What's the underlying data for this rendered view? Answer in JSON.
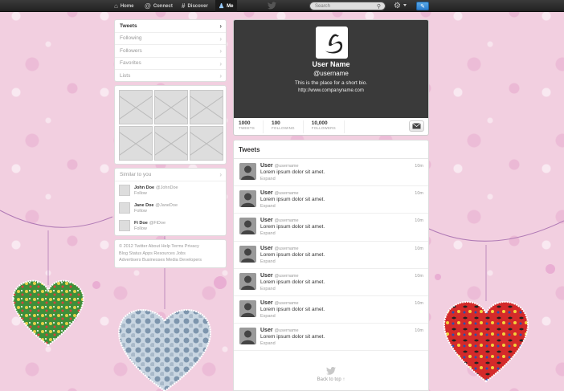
{
  "topbar": {
    "nav": [
      {
        "label": "Home",
        "icon": "home-icon"
      },
      {
        "label": "Connect",
        "icon": "at-icon"
      },
      {
        "label": "Discover",
        "icon": "hash-icon"
      },
      {
        "label": "Me",
        "icon": "person-icon"
      }
    ],
    "search_placeholder": "Search"
  },
  "sidebar": {
    "items": [
      {
        "label": "Tweets"
      },
      {
        "label": "Following"
      },
      {
        "label": "Followers"
      },
      {
        "label": "Favorites"
      },
      {
        "label": "Lists"
      }
    ]
  },
  "similar": {
    "header": "Similar to you",
    "users": [
      {
        "name": "John Doe",
        "handle": "@JohnDoe",
        "follow": "Follow"
      },
      {
        "name": "Jane Doe",
        "handle": "@JaneDoe",
        "follow": "Follow"
      },
      {
        "name": "Fi Doe",
        "handle": "@FiDoe",
        "follow": "Follow"
      }
    ]
  },
  "footer": {
    "line1": "© 2012 Twitter  About  Help  Terms  Privacy",
    "line2": "Blog  Status  Apps  Resources  Jobs",
    "line3": "Advertisers  Businesses  Media  Developers"
  },
  "profile": {
    "name": "User Name",
    "username": "@username",
    "bio": "This is the place for a short bio.",
    "url": "http://www.companyname.com",
    "stats": [
      {
        "value": "1000",
        "label": "TWEETS"
      },
      {
        "value": "100",
        "label": "FOLLOWING"
      },
      {
        "value": "10,000",
        "label": "FOLLOWERS"
      }
    ]
  },
  "tweets": {
    "header": "Tweets",
    "items": [
      {
        "name": "User",
        "handle": "@username",
        "text": "Lorem ipsum dolor sit amet.",
        "expand": "Expand",
        "time": "10m"
      },
      {
        "name": "User",
        "handle": "@username",
        "text": "Lorem ipsum dolor sit amet.",
        "expand": "Expand",
        "time": "10m"
      },
      {
        "name": "User",
        "handle": "@username",
        "text": "Lorem ipsum dolor sit amet.",
        "expand": "Expand",
        "time": "10m"
      },
      {
        "name": "User",
        "handle": "@username",
        "text": "Lorem ipsum dolor sit amet.",
        "expand": "Expand",
        "time": "10m"
      },
      {
        "name": "User",
        "handle": "@username",
        "text": "Lorem ipsum dolor sit amet.",
        "expand": "Expand",
        "time": "10m"
      },
      {
        "name": "User",
        "handle": "@username",
        "text": "Lorem ipsum dolor sit amet.",
        "expand": "Expand",
        "time": "10m"
      },
      {
        "name": "User",
        "handle": "@username",
        "text": "Lorem ipsum dolor sit amet.",
        "expand": "Expand",
        "time": "10m"
      }
    ],
    "back_to_top": "Back to top ↑"
  },
  "colors": {
    "background_pink": "#f2cfe0",
    "topbar": "#222222",
    "profile_header": "#3a3a3a",
    "compose_blue": "#2b7fd0"
  }
}
